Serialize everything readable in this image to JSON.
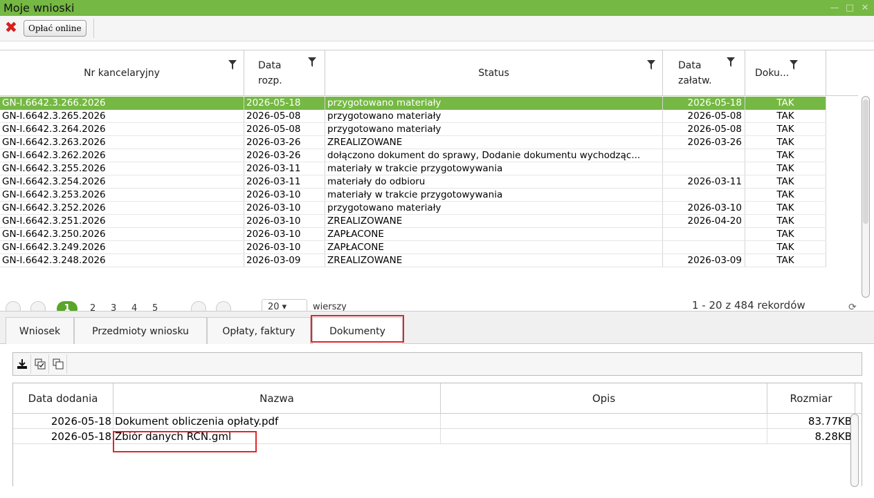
{
  "window": {
    "title": "Moje wnioski"
  },
  "toolbar": {
    "pay_online": "Opłać online"
  },
  "grid": {
    "columns": [
      "Nr kancelaryjny",
      "Data rozp.",
      "Status",
      "Data załatw.",
      "Doku..."
    ],
    "rows": [
      [
        "GN-I.6642.3.266.2026",
        "2026-05-18",
        "przygotowano materiały",
        "2026-05-18",
        "TAK"
      ],
      [
        "GN-I.6642.3.265.2026",
        "2026-05-08",
        "przygotowano materiały",
        "2026-05-08",
        "TAK"
      ],
      [
        "GN-I.6642.3.264.2026",
        "2026-05-08",
        "przygotowano materiały",
        "2026-05-08",
        "TAK"
      ],
      [
        "GN-I.6642.3.263.2026",
        "2026-03-26",
        "ZREALIZOWANE",
        "2026-03-26",
        "TAK"
      ],
      [
        "GN-I.6642.3.262.2026",
        "2026-03-26",
        "dołączono dokument do sprawy, Dodanie dokumentu wychodząc...",
        "",
        "TAK"
      ],
      [
        "GN-I.6642.3.255.2026",
        "2026-03-11",
        "materiały w trakcie przygotowywania",
        "",
        "TAK"
      ],
      [
        "GN-I.6642.3.254.2026",
        "2026-03-11",
        "materiały do odbioru",
        "2026-03-11",
        "TAK"
      ],
      [
        "GN-I.6642.3.253.2026",
        "2026-03-10",
        "materiały w trakcie przygotowywania",
        "",
        "TAK"
      ],
      [
        "GN-I.6642.3.252.2026",
        "2026-03-10",
        "przygotowano materiały",
        "2026-03-10",
        "TAK"
      ],
      [
        "GN-I.6642.3.251.2026",
        "2026-03-10",
        "ZREALIZOWANE",
        "2026-04-20",
        "TAK"
      ],
      [
        "GN-I.6642.3.250.2026",
        "2026-03-10",
        "ZAPŁACONE",
        "",
        "TAK"
      ],
      [
        "GN-I.6642.3.249.2026",
        "2026-03-10",
        "ZAPŁACONE",
        "",
        "TAK"
      ],
      [
        "GN-I.6642.3.248.2026",
        "2026-03-09",
        "ZREALIZOWANE",
        "2026-03-09",
        "TAK"
      ]
    ],
    "selected_index": 0
  },
  "pager": {
    "current": "1",
    "pages": [
      "2",
      "3",
      "4",
      "5"
    ],
    "per_page": "20",
    "per_page_label": "wierszy",
    "records": "1 - 20 z 484 rekordów"
  },
  "tabs": [
    "Wniosek",
    "Przedmioty wniosku",
    "Opłaty, faktury",
    "Dokumenty"
  ],
  "active_tab": 3,
  "documents": {
    "columns": [
      "Data dodania",
      "Nazwa",
      "Opis",
      "Rozmiar"
    ],
    "rows": [
      [
        "2026-05-18",
        "Dokument obliczenia opłaty.pdf",
        "",
        "83.77KB"
      ],
      [
        "2026-05-18",
        "Zbiór danych RCN.gml",
        "",
        "8.28KB"
      ]
    ]
  },
  "icons": [
    "close-icon",
    "filter-icon",
    "download-icon",
    "check-all-icon",
    "select-icon",
    "refresh-icon"
  ],
  "colors": {
    "titlebar": "#75b843",
    "selection": "#75b843",
    "highlight": "#e0262a",
    "close": "#d61f1f"
  }
}
